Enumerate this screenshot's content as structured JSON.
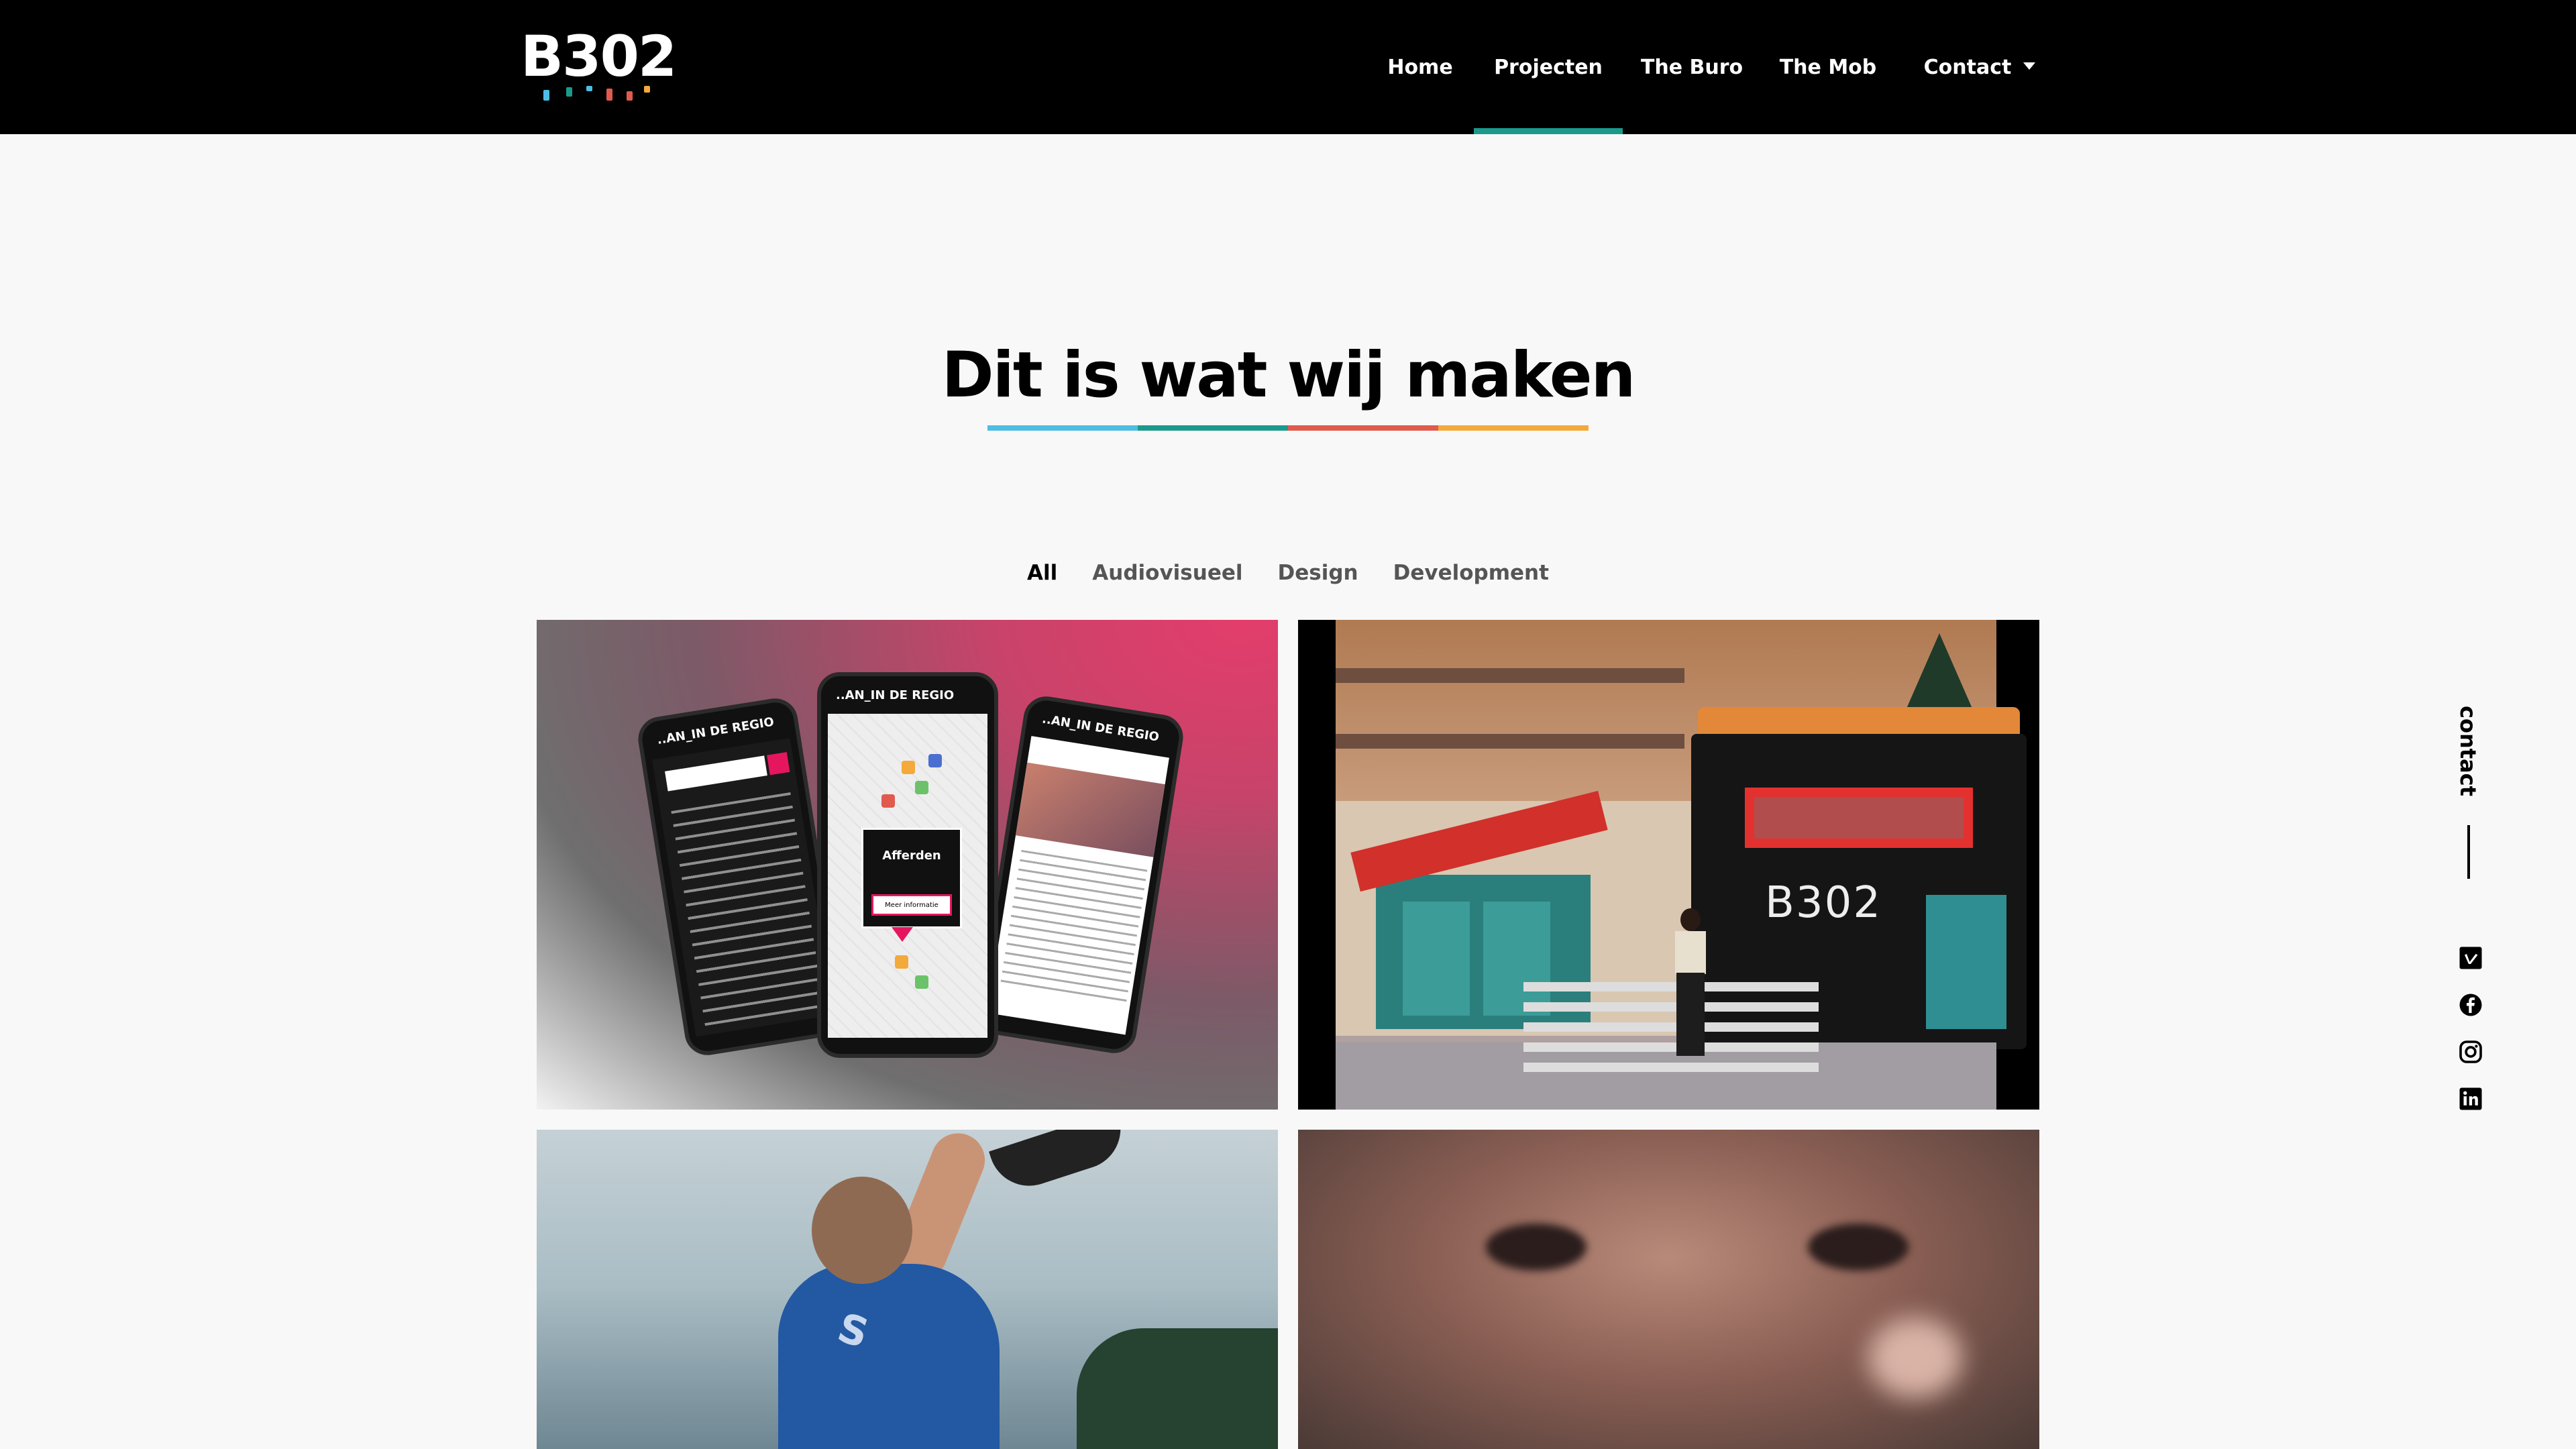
{
  "brand": {
    "logo_text": "B302",
    "logo_mark_colors": [
      "#4ebde3",
      "#1b9a8c",
      "#e05a4e",
      "#f4a93b"
    ]
  },
  "nav": {
    "items": [
      {
        "label": "Home"
      },
      {
        "label": "Projecten",
        "active": true
      },
      {
        "label": "The Buro"
      },
      {
        "label": "The Mob"
      },
      {
        "label": "Contact",
        "has_dropdown": true
      }
    ],
    "active_color": "#1b9a8c"
  },
  "page": {
    "title": "Dit is wat wij maken",
    "title_bar_colors": [
      "#4ebde3",
      "#1b9a8c",
      "#e05a4e",
      "#f4a93b"
    ]
  },
  "filters": [
    {
      "label": "All",
      "active": true
    },
    {
      "label": "Audiovisueel"
    },
    {
      "label": "Design"
    },
    {
      "label": "Development"
    }
  ],
  "projects": {
    "card1": {
      "phone_header": "..AN_IN DE REGIO",
      "popup_title": "Afferden",
      "popup_button": "Meer informatie"
    },
    "card2": {
      "sign_text": "B302"
    },
    "card3": {
      "shirt_text": "S"
    }
  },
  "sidebar": {
    "contact_label": "contact",
    "social_icons": [
      "vimeo-icon",
      "facebook-icon",
      "instagram-icon",
      "linkedin-icon"
    ]
  }
}
